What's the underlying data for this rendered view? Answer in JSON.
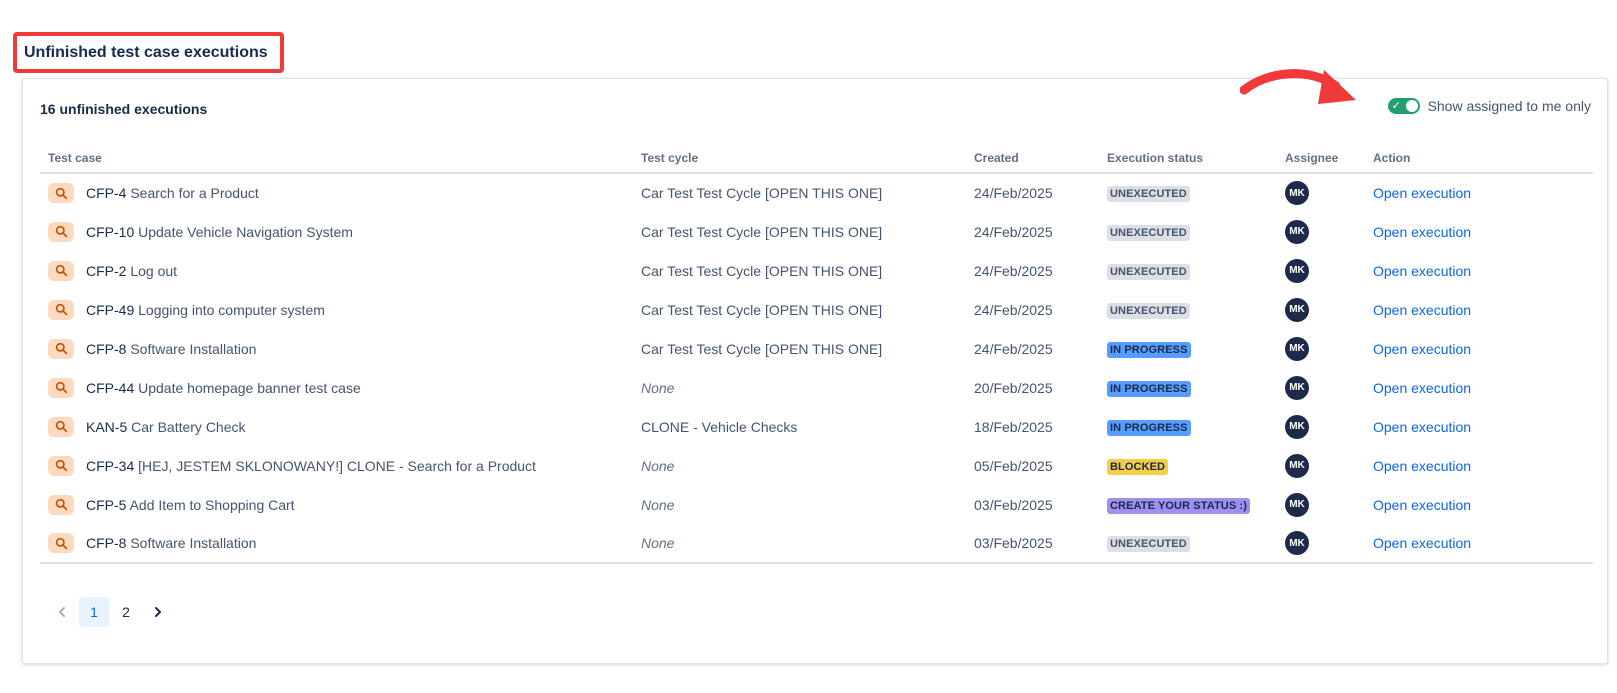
{
  "section_title": "Unfinished test case executions",
  "count_label": "16 unfinished executions",
  "toggle": {
    "label": "Show assigned to me only",
    "on": true,
    "color": "#22a06b"
  },
  "columns": {
    "test_case": "Test case",
    "test_cycle": "Test cycle",
    "created": "Created",
    "status": "Execution status",
    "assignee": "Assignee",
    "action": "Action"
  },
  "status_colors": {
    "UNEXECUTED": {
      "bg": "#dcdfe4",
      "fg": "#44546f"
    },
    "IN PROGRESS": {
      "bg": "#579dff",
      "fg": "#172b4d"
    },
    "BLOCKED": {
      "bg": "#f5cd47",
      "fg": "#172b4d"
    },
    "CREATE YOUR STATUS :)": {
      "bg": "#9f8fef",
      "fg": "#172b4d"
    }
  },
  "rows": [
    {
      "key": "CFP-4",
      "name": "Search for a Product",
      "cycle": "Car Test Test Cycle [OPEN THIS ONE]",
      "cycle_none": false,
      "created": "24/Feb/2025",
      "status": "UNEXECUTED",
      "assignee": "MK",
      "action": "Open execution"
    },
    {
      "key": "CFP-10",
      "name": "Update Vehicle Navigation System",
      "cycle": "Car Test Test Cycle [OPEN THIS ONE]",
      "cycle_none": false,
      "created": "24/Feb/2025",
      "status": "UNEXECUTED",
      "assignee": "MK",
      "action": "Open execution"
    },
    {
      "key": "CFP-2",
      "name": "Log out",
      "cycle": "Car Test Test Cycle [OPEN THIS ONE]",
      "cycle_none": false,
      "created": "24/Feb/2025",
      "status": "UNEXECUTED",
      "assignee": "MK",
      "action": "Open execution"
    },
    {
      "key": "CFP-49",
      "name": "Logging into computer system",
      "cycle": "Car Test Test Cycle [OPEN THIS ONE]",
      "cycle_none": false,
      "created": "24/Feb/2025",
      "status": "UNEXECUTED",
      "assignee": "MK",
      "action": "Open execution"
    },
    {
      "key": "CFP-8",
      "name": "Software Installation",
      "cycle": "Car Test Test Cycle [OPEN THIS ONE]",
      "cycle_none": false,
      "created": "24/Feb/2025",
      "status": "IN PROGRESS",
      "assignee": "MK",
      "action": "Open execution"
    },
    {
      "key": "CFP-44",
      "name": "Update homepage banner test case",
      "cycle": "None",
      "cycle_none": true,
      "created": "20/Feb/2025",
      "status": "IN PROGRESS",
      "assignee": "MK",
      "action": "Open execution"
    },
    {
      "key": "KAN-5",
      "name": "Car Battery Check",
      "cycle": "CLONE - Vehicle Checks",
      "cycle_none": false,
      "created": "18/Feb/2025",
      "status": "IN PROGRESS",
      "assignee": "MK",
      "action": "Open execution"
    },
    {
      "key": "CFP-34",
      "name": "[HEJ, JESTEM SKLONOWANY!] CLONE - Search for a Product",
      "cycle": "None",
      "cycle_none": true,
      "created": "05/Feb/2025",
      "status": "BLOCKED",
      "assignee": "MK",
      "action": "Open execution"
    },
    {
      "key": "CFP-5",
      "name": "Add Item to Shopping Cart",
      "cycle": "None",
      "cycle_none": true,
      "created": "03/Feb/2025",
      "status": "CREATE YOUR STATUS :)",
      "assignee": "MK",
      "action": "Open execution"
    },
    {
      "key": "CFP-8",
      "name": "Software Installation",
      "cycle": "None",
      "cycle_none": true,
      "created": "03/Feb/2025",
      "status": "UNEXECUTED",
      "assignee": "MK",
      "action": "Open execution"
    }
  ],
  "pagination": {
    "pages": [
      "1",
      "2"
    ],
    "current": "1"
  },
  "icons": {
    "test_case": "search-icon",
    "prev": "chevron-left-icon",
    "next": "chevron-right-icon",
    "toggle_check": "check-icon"
  }
}
